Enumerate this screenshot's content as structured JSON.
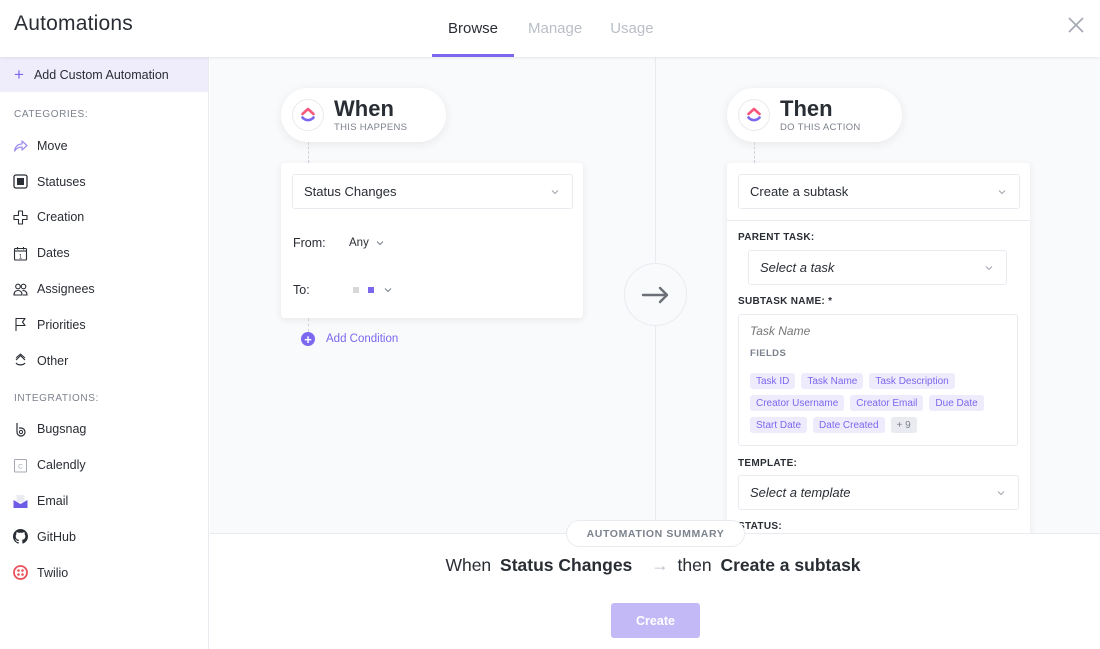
{
  "header": {
    "title": "Automations",
    "tabs": [
      {
        "label": "Browse",
        "active": true
      },
      {
        "label": "Manage",
        "active": false
      },
      {
        "label": "Usage",
        "active": false
      }
    ],
    "close_icon": "close-icon"
  },
  "sidebar": {
    "add_custom_label": "Add Custom Automation",
    "categories_label": "CATEGORIES:",
    "categories": [
      {
        "label": "Move",
        "icon": "move-arrow-icon"
      },
      {
        "label": "Statuses",
        "icon": "status-square-icon"
      },
      {
        "label": "Creation",
        "icon": "plus-outline-icon"
      },
      {
        "label": "Dates",
        "icon": "calendar-icon"
      },
      {
        "label": "Assignees",
        "icon": "people-icon"
      },
      {
        "label": "Priorities",
        "icon": "flag-icon"
      },
      {
        "label": "Other",
        "icon": "other-icon"
      }
    ],
    "integrations_label": "INTEGRATIONS:",
    "integrations": [
      {
        "label": "Bugsnag",
        "icon": "bugsnag-icon"
      },
      {
        "label": "Calendly",
        "icon": "calendly-icon"
      },
      {
        "label": "Email",
        "icon": "email-icon"
      },
      {
        "label": "GitHub",
        "icon": "github-icon"
      },
      {
        "label": "Twilio",
        "icon": "twilio-icon"
      }
    ]
  },
  "when": {
    "title": "When",
    "subtitle": "THIS HAPPENS",
    "trigger_value": "Status Changes",
    "from_label": "From:",
    "from_value": "Any",
    "to_label": "To:",
    "to_colors": [
      "#d8d8d8",
      "#7b68ee"
    ],
    "add_condition_label": "Add Condition"
  },
  "then": {
    "title": "Then",
    "subtitle": "DO THIS ACTION",
    "action_value": "Create a subtask",
    "parent_task_label": "PARENT TASK:",
    "parent_task_placeholder": "Select a task",
    "subtask_name_label": "SUBTASK NAME: *",
    "task_name_placeholder": "Task Name",
    "fields_label": "FIELDS",
    "fields": [
      "Task ID",
      "Task Name",
      "Task Description",
      "Creator Username",
      "Creator Email",
      "Due Date",
      "Start Date",
      "Date Created"
    ],
    "more_fields": "+ 9",
    "template_label": "TEMPLATE:",
    "template_placeholder": "Select a template",
    "status_label": "STATUS:"
  },
  "summary": {
    "badge": "AUTOMATION SUMMARY",
    "when_word": "When",
    "trigger": "Status Changes",
    "then_word": "then",
    "action": "Create a subtask",
    "create_label": "Create"
  },
  "colors": {
    "accent": "#7b68ee",
    "create_disabled": "#c2b9f6"
  }
}
